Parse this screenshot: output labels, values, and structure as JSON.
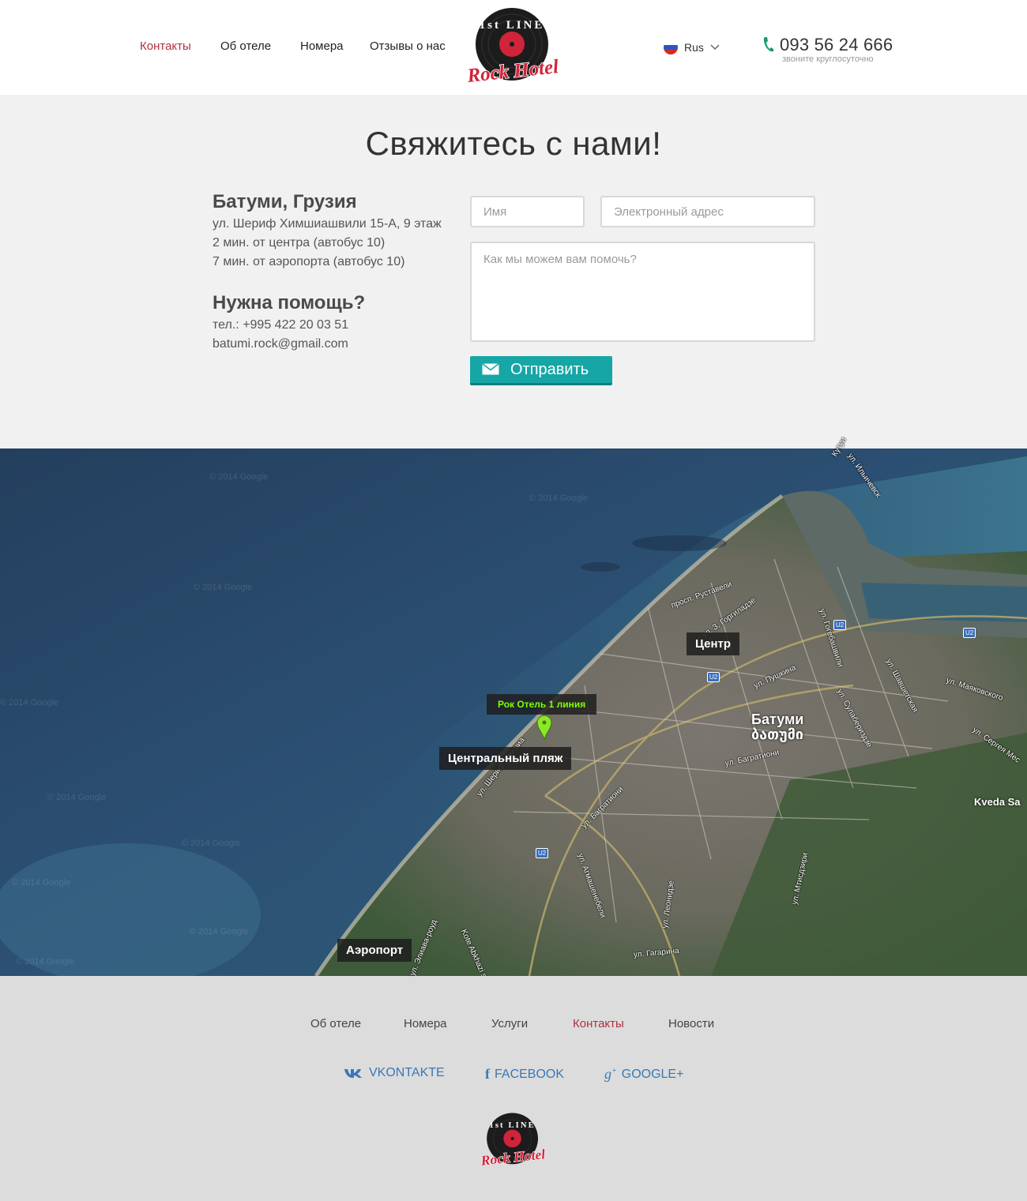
{
  "header": {
    "nav": [
      {
        "label": "Контакты",
        "active": true
      },
      {
        "label": "Об отеле"
      },
      {
        "label": "Номера"
      },
      {
        "label": "Отзывы о нас"
      }
    ],
    "logo": {
      "top": "1st LINE",
      "bottom": "Rock Hotel"
    },
    "language": "Rus",
    "phone": "093 56 24 666",
    "phone_note": "звоните круглосуточно"
  },
  "contact": {
    "title": "Свяжитесь с нами!",
    "location_heading": "Батуми, Грузия",
    "address": [
      "ул. Шериф Химшиашвили 15-А, 9 этаж",
      "2 мин. от центра (автобус 10)",
      "7 мин. от аэропорта (автобус 10)"
    ],
    "help_heading": "Нужна помощь?",
    "phone": "тел.: +995 422 20 03 51",
    "email": "batumi.rock@gmail.com",
    "form": {
      "name_placeholder": "Имя",
      "email_placeholder": "Электронный адрес",
      "message_placeholder": "Как мы можем вам помочь?",
      "submit_label": "Отправить"
    }
  },
  "map": {
    "labels": {
      "hotel": "Рок Отель 1 линия",
      "center": "Центр",
      "beach": "Центральный пляж",
      "airport": "Аэропорт"
    },
    "city": {
      "ru": "Батуми",
      "ka": "ბათუმი"
    },
    "streets": [
      "ул. Гогебашвили",
      "просп. Руставели",
      "ул. З. Горгиладзе",
      "ул. Пушкина",
      "ул. Шавшетская",
      "ул. Маяковского",
      "ул. Сулабериздзе",
      "ул. Сергея Мес",
      "ул. Багратиони",
      "ул. Багратиони",
      "ул. Шериф Химшиа",
      "ул. Агмашенебели",
      "ул. Леонидзе",
      "ул. Мтисдзири",
      "ул. Гагарина",
      "ул. Элиава-роуд",
      "Kote Abkhazi str",
      "ул. Ильичевск",
      "Кутуи"
    ],
    "road_shield": "U2",
    "place": "Kveda Sa",
    "watermark": "© 2014 Google"
  },
  "footer": {
    "nav": [
      {
        "label": "Об отеле"
      },
      {
        "label": "Номера"
      },
      {
        "label": "Услуги"
      },
      {
        "label": "Контакты",
        "active": true
      },
      {
        "label": "Новости"
      }
    ],
    "social": [
      {
        "label": "VKONTAKTE",
        "icon": "vk-icon"
      },
      {
        "label": "FACEBOOK",
        "icon": "facebook-icon"
      },
      {
        "label": "GOOGLE+",
        "icon": "google-plus-icon"
      }
    ]
  },
  "colors": {
    "accent": "#b1303f",
    "teal": "#16a6a6",
    "social_blue": "#3a78b8",
    "footer_bg": "#dcdcdc",
    "section_bg": "#f1f1f1"
  }
}
